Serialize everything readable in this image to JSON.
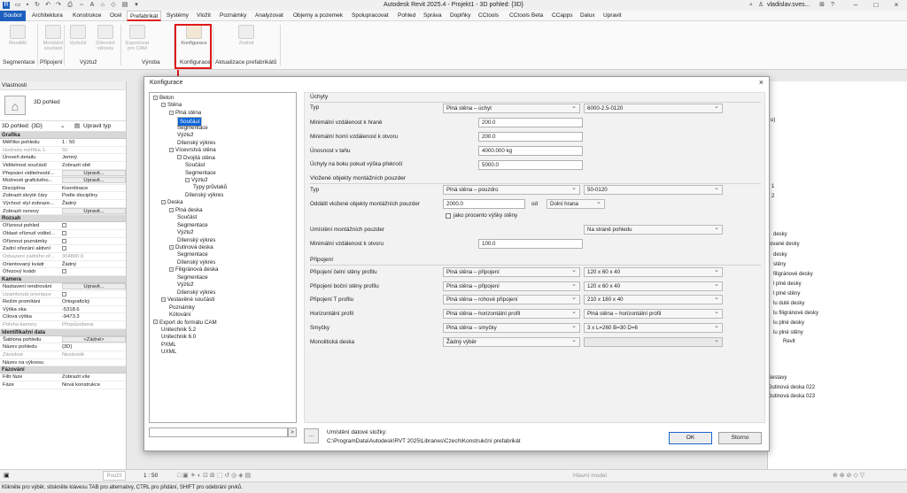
{
  "window": {
    "title": "Autodesk Revit 2025.4 - Projekt1 - 3D pohled: {3D}",
    "user": "vladislav.sves..."
  },
  "ribbon": {
    "tabs": [
      "Soubor",
      "Architektura",
      "Konstrukce",
      "Ocel",
      "Prefabrikát",
      "Systémy",
      "Vložit",
      "Poznámky",
      "Analyzovat",
      "Objemy a pozemek",
      "Spolupracovat",
      "Pohled",
      "Správa",
      "Doplňky",
      "CCtools",
      "CCtools Beta",
      "CCapps",
      "Dalux",
      "Upravit"
    ],
    "active_tab": "Prefabrikát",
    "buttons": [
      "Rozdělit",
      "Montážní součásti",
      "Vyztužit",
      "Dílenské výkresy",
      "Exportovat pro CAM",
      "Konfigurace",
      "Změnit"
    ],
    "groups": [
      "Segmentace",
      "Připojení",
      "Výztuž",
      "Výroba",
      "Konfigurace",
      "Aktualizace prefabrikátů"
    ]
  },
  "properties": {
    "header": "Vlastnosti",
    "type_name": "3D pohled",
    "view_selector": "3D pohled: {3D}",
    "edit_type": "Upravit typ",
    "sections": [
      {
        "title": "Grafika",
        "rows": [
          {
            "k": "Měřítko pohledu",
            "v": "1 : 50"
          },
          {
            "k": "Hodnota měřítka   1:",
            "v": "50",
            "dim": true
          },
          {
            "k": "Úroveň detailu",
            "v": "Jemný"
          },
          {
            "k": "Viditelnost součástí",
            "v": "Zobrazit obě"
          },
          {
            "k": "Přepsání viditelnosti/...",
            "v": "Upravit...",
            "btn": true
          },
          {
            "k": "Možnosti grafického...",
            "v": "Upravit...",
            "btn": true
          },
          {
            "k": "Disciplína",
            "v": "Koordinace"
          },
          {
            "k": "Zobrazit skryté čáry",
            "v": "Podle disciplíny"
          },
          {
            "k": "Výchozí styl zobraze...",
            "v": "Žádný"
          },
          {
            "k": "Zobrazit osnovy",
            "v": "Upravit...",
            "btn": true
          }
        ]
      },
      {
        "title": "Rozsah",
        "rows": [
          {
            "k": "Oříznout pohled",
            "cb": true
          },
          {
            "k": "Oblast oříznutí viditel...",
            "cb": true
          },
          {
            "k": "Oříznout poznámky",
            "cb": true
          },
          {
            "k": "Zadní ořezání aktivní",
            "cb": true
          },
          {
            "k": "Odsazení zadního oř...",
            "v": "304800.0",
            "dim": true
          },
          {
            "k": "Orientovaný kvádr",
            "v": "Žádný"
          },
          {
            "k": "Ořezový kvádr",
            "cb": true
          }
        ]
      },
      {
        "title": "Kamera",
        "rows": [
          {
            "k": "Nastavení rendrování",
            "v": "Upravit...",
            "btn": true
          },
          {
            "k": "Uzamknutá orientace",
            "cb": true,
            "dim": true
          },
          {
            "k": "Režim promítání",
            "v": "Ortografický"
          },
          {
            "k": "Výška oka",
            "v": "-5318.6"
          },
          {
            "k": "Cílová výška",
            "v": "-9473.3"
          },
          {
            "k": "Poloha kamery",
            "v": "Přizpůsobená",
            "dim": true
          }
        ]
      },
      {
        "title": "Identifikační data",
        "rows": [
          {
            "k": "Šablona pohledu",
            "v": "<Žádné>",
            "btn": true
          },
          {
            "k": "Název pohledu",
            "v": "{3D}"
          },
          {
            "k": "Závislost",
            "v": "Nezávislé",
            "dim": true
          },
          {
            "k": "Název na výkresu",
            "v": ""
          }
        ]
      },
      {
        "title": "Fázování",
        "rows": [
          {
            "k": "Filtr fáze",
            "v": "Zobrazit vše"
          },
          {
            "k": "Fáze",
            "v": "Nová konstrukce"
          }
        ]
      }
    ],
    "apply": "Použít"
  },
  "browser": {
    "items": [
      "u)",
      "1",
      "2",
      "desky",
      "rované desky",
      "desky",
      "stěny",
      "filigránové desky",
      "l plné desky",
      "l plné stěny",
      "lu duté desky",
      "lu filigránové desky",
      "lu plné desky",
      "lu plné stěny",
      "Revit",
      "Sestavy",
      "Dutinová deska 022",
      "Dutinová deska 023"
    ]
  },
  "status": {
    "scale": "1 : 50",
    "hint": "Klikněte pro výběr, stiskněte klávesu TAB pro alternativy, CTRL pro přidání, SHIFT pro odebrání prvků.",
    "model": "Hlavní model"
  },
  "dialog": {
    "title": "Konfigurace",
    "tree": [
      {
        "label": "Beton",
        "level": 0,
        "box": "-"
      },
      {
        "label": "Stěna",
        "level": 1,
        "box": "-"
      },
      {
        "label": "Plná stěna",
        "level": 2,
        "box": "-"
      },
      {
        "label": "Součást",
        "level": 3,
        "selected": true
      },
      {
        "label": "Segmentace",
        "level": 3
      },
      {
        "label": "Výztuž",
        "level": 3
      },
      {
        "label": "Dílenský výkres",
        "level": 3
      },
      {
        "label": "Vícevrstvá stěna",
        "level": 2,
        "box": "-"
      },
      {
        "label": "Dvojitá stěna",
        "level": 3,
        "box": "-"
      },
      {
        "label": "Součást",
        "level": 4
      },
      {
        "label": "Segmentace",
        "level": 4
      },
      {
        "label": "Výztuž",
        "level": 4,
        "box": "-"
      },
      {
        "label": "Typy průvlaků",
        "level": 5
      },
      {
        "label": "Dílenský výkres",
        "level": 4
      },
      {
        "label": "Deska",
        "level": 1,
        "box": "-"
      },
      {
        "label": "Plná deska",
        "level": 2,
        "box": "-"
      },
      {
        "label": "Součást",
        "level": 3
      },
      {
        "label": "Segmentace",
        "level": 3
      },
      {
        "label": "Výztuž",
        "level": 3
      },
      {
        "label": "Dílenský výkres",
        "level": 3
      },
      {
        "label": "Dutinová deska",
        "level": 2,
        "box": "-"
      },
      {
        "label": "Segmentace",
        "level": 3
      },
      {
        "label": "Dílenský výkres",
        "level": 3
      },
      {
        "label": "Filigránová deska",
        "level": 2,
        "box": "-"
      },
      {
        "label": "Segmentace",
        "level": 3
      },
      {
        "label": "Výztuž",
        "level": 3
      },
      {
        "label": "Dílenský výkres",
        "level": 3
      },
      {
        "label": "Vestavěné součásti",
        "level": 1,
        "box": "-"
      },
      {
        "label": "Poznámky",
        "level": 2
      },
      {
        "label": "Kótování",
        "level": 2
      },
      {
        "label": "Export do formátu CAM",
        "level": 0,
        "box": "-"
      },
      {
        "label": "Unitechnik 5.2",
        "level": 1
      },
      {
        "label": "Unitechnik 6.0",
        "level": 1
      },
      {
        "label": "PXML",
        "level": 1
      },
      {
        "label": "UXML",
        "level": 1
      }
    ],
    "uchyty": {
      "title": "Úchyty",
      "typ_label": "Typ",
      "typ_value": "Plná stěna – úchyt",
      "typ_code": "6000-2.5-0120",
      "min_edge_label": "Minimální vzdálenost k hraně",
      "min_edge": "200.0",
      "min_top_label": "Minimální horní vzdálenost k otvoru",
      "min_top": "200.0",
      "capacity_label": "Únosnost v tahu",
      "capacity": "4000.000 kg",
      "side_label": "Úchyty na boku pokud výška překročí",
      "side": "5000.0"
    },
    "vlozene": {
      "title": "Vložené objekty montážních pouzder",
      "typ_label": "Typ",
      "typ_value": "Plná stěna – pouzdro",
      "typ_code": "50-0120",
      "offset_label": "Oddálit vložené objekty montážních pouzder",
      "offset": "2000.0",
      "od": "od",
      "edge": "Dolní hrana",
      "percent_label": "jako procento výšky stěny",
      "place_label": "Umístění montážních pouzder",
      "place": "Na straně pohledu",
      "min_label": "Minimální vzdálenost k otvoru",
      "min": "100.0"
    },
    "pripojeni": {
      "title": "Připojení",
      "rows": [
        {
          "label": "Připojení čelní stěny profilu",
          "type": "Plná stěna – připojení",
          "size": "120 x 60 x 40"
        },
        {
          "label": "Připojení boční stěny profilu",
          "type": "Plná stěna – připojení",
          "size": "120 x 60 x 40"
        },
        {
          "label": "Připojení T profilu",
          "type": "Plná stěna – rohové připojení",
          "size": "210 x 180 x 40"
        },
        {
          "label": "Horizontální profil",
          "type": "Plná stěna – horizontální profil",
          "size": "Plná stěna – horizontální profil"
        },
        {
          "label": "Smyčky",
          "type": "Plná stěna – smyčky",
          "size": "3 x L=260 B=30 D=6"
        },
        {
          "label": "Monolitická deska",
          "type": "Žádný výběr",
          "size": ""
        }
      ]
    },
    "path_label": "Umístění datové složky:",
    "path_value": "C:\\ProgramData\\Autodesk\\RVT 2025\\Libraries\\Czech\\Konstrukční prefabrikát",
    "ok": "OK",
    "cancel": "Storno"
  }
}
